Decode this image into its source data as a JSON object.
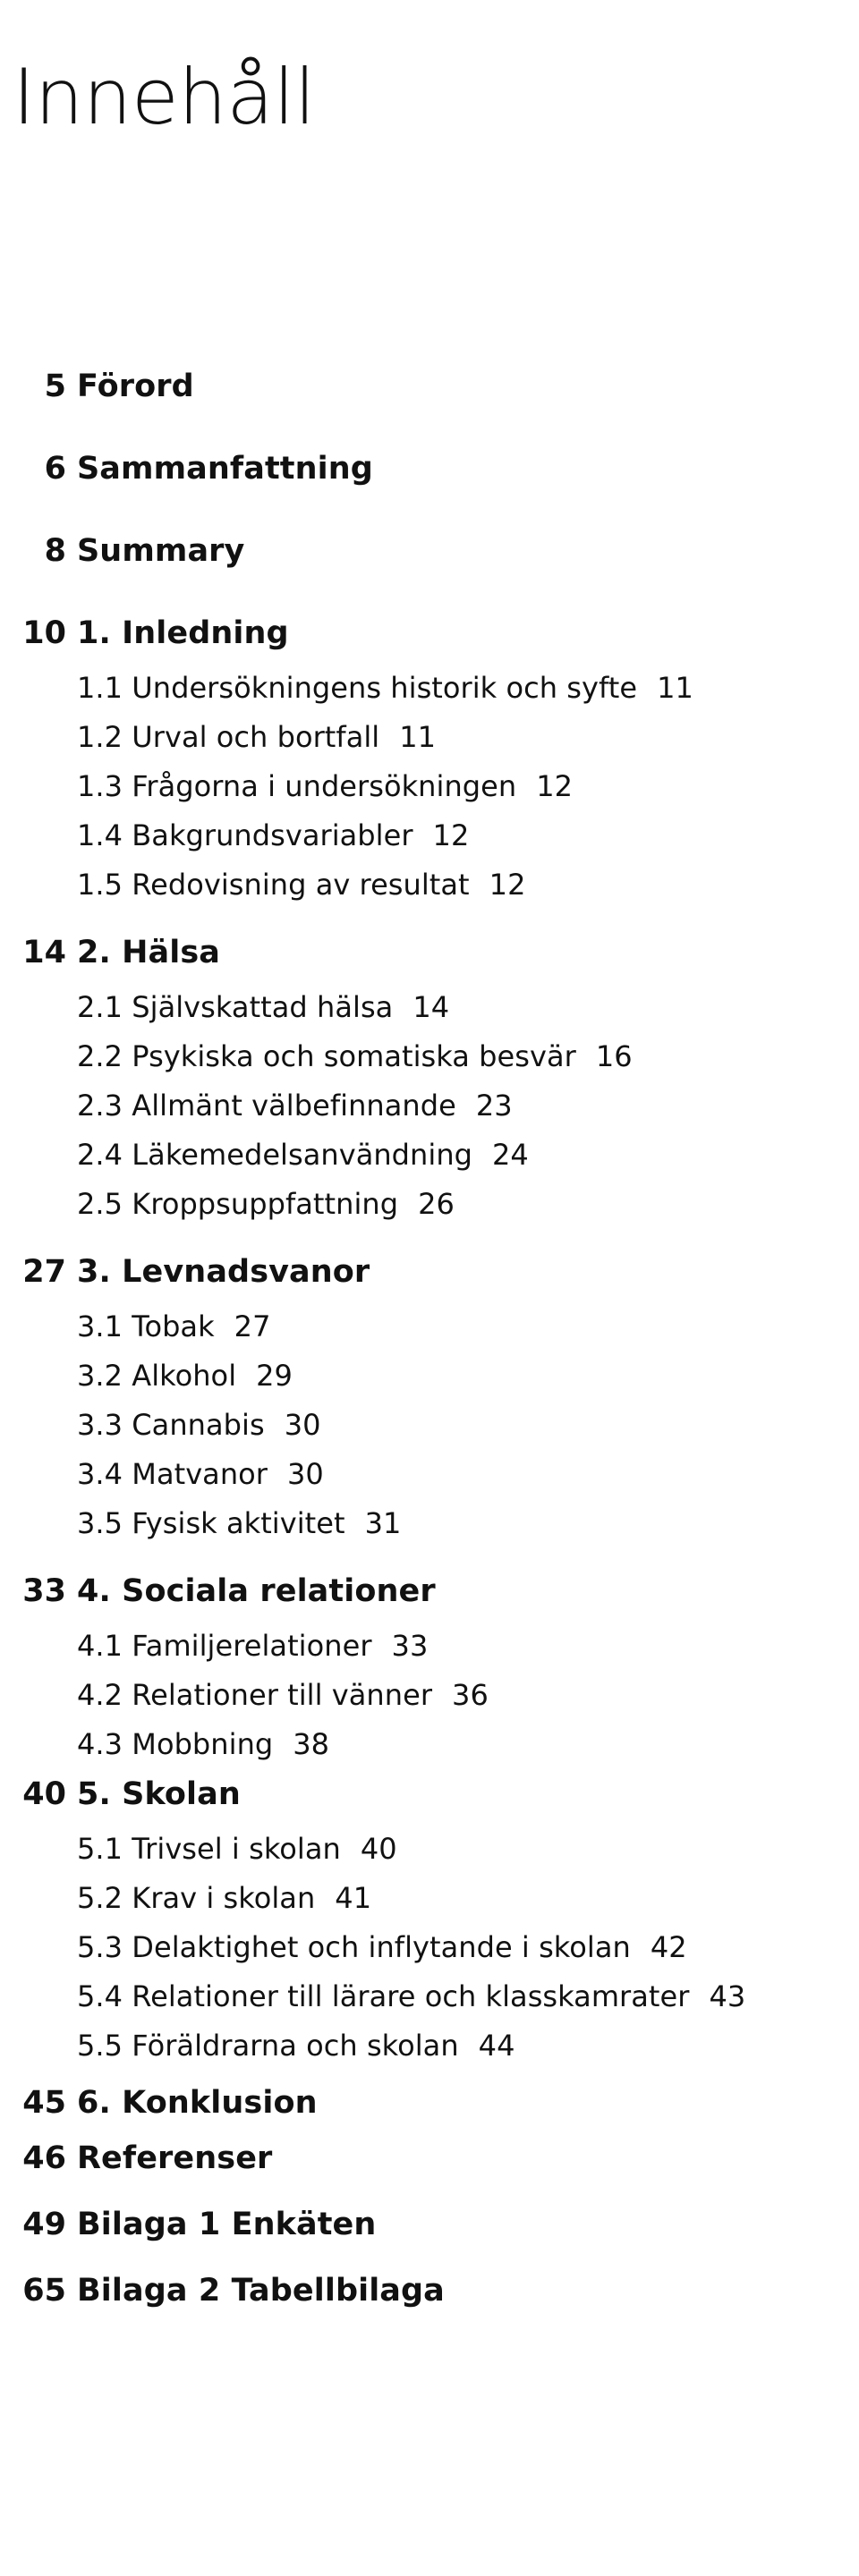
{
  "document": {
    "title": "Innehåll",
    "language": "sv"
  },
  "front_matter": [
    {
      "page": "5",
      "label": "Förord"
    },
    {
      "page": "6",
      "label": "Sammanfattning"
    },
    {
      "page": "8",
      "label": "Summary"
    }
  ],
  "chapters": [
    {
      "page": "10",
      "number": "1.",
      "label": "Inledning",
      "sections": [
        {
          "number": "1.1",
          "label": "Undersökningens historik och syfte",
          "page": "11"
        },
        {
          "number": "1.2",
          "label": "Urval och bortfall",
          "page": "11"
        },
        {
          "number": "1.3",
          "label": "Frågorna i undersökningen",
          "page": "12"
        },
        {
          "number": "1.4",
          "label": "Bakgrundsvariabler",
          "page": "12"
        },
        {
          "number": "1.5",
          "label": "Redovisning av resultat",
          "page": "12"
        }
      ]
    },
    {
      "page": "14",
      "number": "2.",
      "label": "Hälsa",
      "sections": [
        {
          "number": "2.1",
          "label": "Självskattad hälsa",
          "page": "14"
        },
        {
          "number": "2.2",
          "label": "Psykiska och somatiska besvär",
          "page": "16"
        },
        {
          "number": "2.3",
          "label": "Allmänt välbefinnande",
          "page": "23"
        },
        {
          "number": "2.4",
          "label": "Läkemedelsanvändning",
          "page": "24"
        },
        {
          "number": "2.5",
          "label": "Kroppsuppfattning",
          "page": "26"
        }
      ]
    },
    {
      "page": "27",
      "number": "3.",
      "label": "Levnadsvanor",
      "sections": [
        {
          "number": "3.1",
          "label": "Tobak",
          "page": "27"
        },
        {
          "number": "3.2",
          "label": "Alkohol",
          "page": "29"
        },
        {
          "number": "3.3",
          "label": "Cannabis",
          "page": "30"
        },
        {
          "number": "3.4",
          "label": "Matvanor",
          "page": "30"
        },
        {
          "number": "3.5",
          "label": "Fysisk aktivitet",
          "page": "31"
        }
      ]
    },
    {
      "page": "33",
      "number": "4.",
      "label": "Sociala relationer",
      "sections": [
        {
          "number": "4.1",
          "label": "Familjerelationer",
          "page": "33"
        },
        {
          "number": "4.2",
          "label": "Relationer till vänner",
          "page": "36"
        },
        {
          "number": "4.3",
          "label": "Mobbning",
          "page": "38"
        }
      ]
    },
    {
      "page": "40",
      "number": "5.",
      "label": "Skolan",
      "sections": [
        {
          "number": "5.1",
          "label": "Trivsel i skolan",
          "page": "40"
        },
        {
          "number": "5.2",
          "label": "Krav i skolan",
          "page": "41"
        },
        {
          "number": "5.3",
          "label": "Delaktighet och inflytande i skolan",
          "page": "42"
        },
        {
          "number": "5.4",
          "label": "Relationer till lärare och klasskamrater",
          "page": "43"
        },
        {
          "number": "5.5",
          "label": "Föräldrarna och skolan",
          "page": "44"
        }
      ]
    },
    {
      "page": "45",
      "number": "6.",
      "label": "Konklusion",
      "sections": []
    }
  ],
  "back_matter": [
    {
      "page": "46",
      "label": "Referenser"
    },
    {
      "page": "49",
      "label": "Bilaga 1 Enkäten"
    },
    {
      "page": "65",
      "label": "Bilaga 2 Tabellbilaga"
    }
  ]
}
